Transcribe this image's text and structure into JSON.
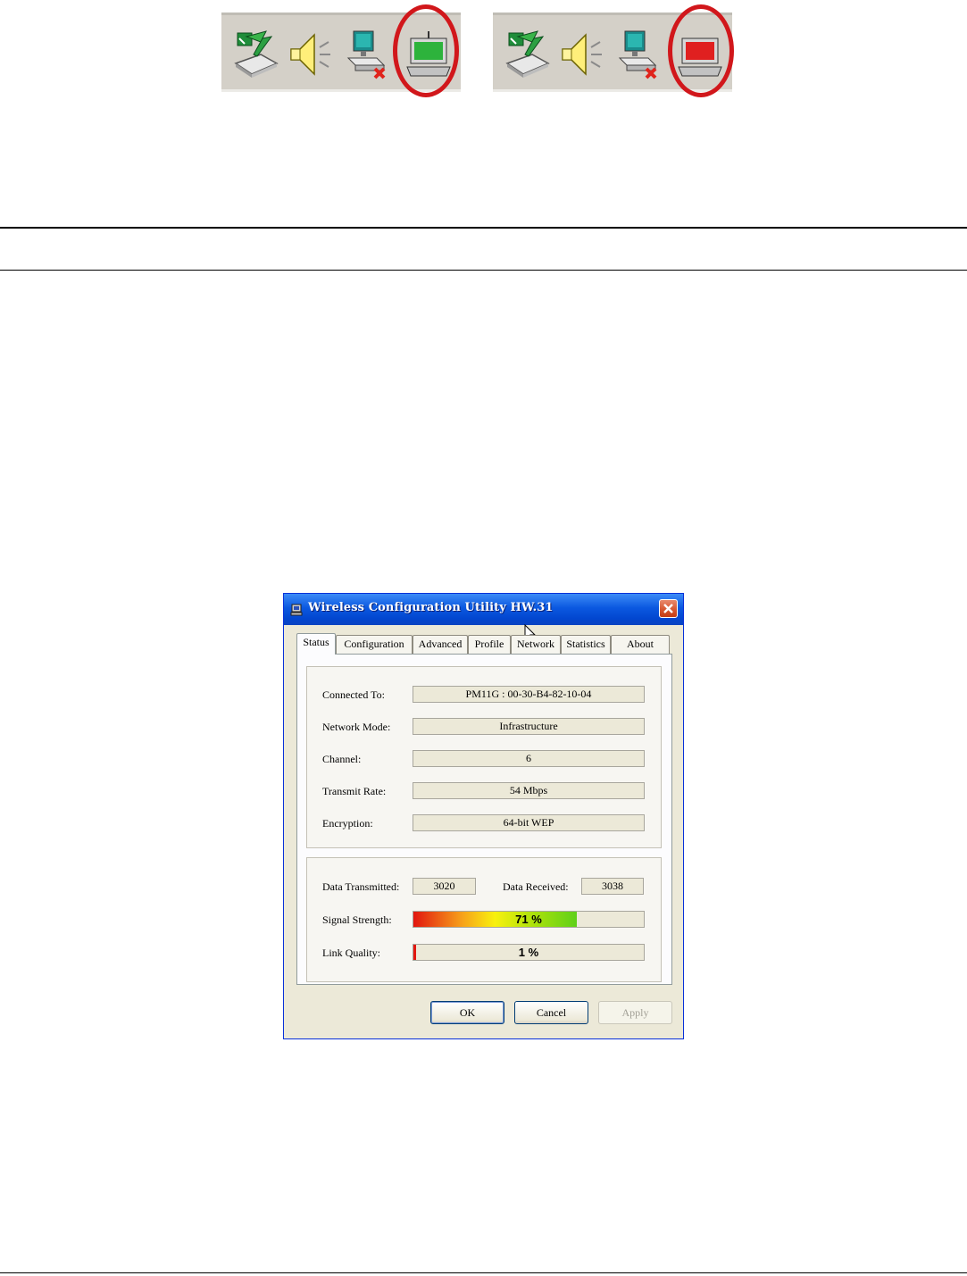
{
  "tray_left": {
    "icons": [
      "scanner-icon",
      "volume-icon",
      "network-disconnected-icon",
      "wireless-utility-connected-icon"
    ],
    "status_color": "#2db33c"
  },
  "tray_right": {
    "icons": [
      "scanner-icon",
      "volume-icon",
      "network-disconnected-icon",
      "wireless-utility-disconnected-icon"
    ],
    "status_color": "#e02020"
  },
  "highlight_color": "#d1171b",
  "dialog": {
    "title": "Wireless Configuration Utility HW.31",
    "tabs": [
      {
        "label": "Status",
        "active": true
      },
      {
        "label": "Configuration",
        "active": false
      },
      {
        "label": "Advanced",
        "active": false
      },
      {
        "label": "Profile",
        "active": false
      },
      {
        "label": "Network",
        "active": false
      },
      {
        "label": "Statistics",
        "active": false
      },
      {
        "label": "About",
        "active": false
      }
    ],
    "info": [
      {
        "label": "Connected To:",
        "value": "PM11G : 00-30-B4-82-10-04"
      },
      {
        "label": "Network Mode:",
        "value": "Infrastructure"
      },
      {
        "label": "Channel:",
        "value": "6"
      },
      {
        "label": "Transmit Rate:",
        "value": "54 Mbps"
      },
      {
        "label": "Encryption:",
        "value": "64-bit WEP"
      }
    ],
    "data_transmitted_label": "Data Transmitted:",
    "data_transmitted": "3020",
    "data_received_label": "Data Received:",
    "data_received": "3038",
    "signal_strength_label": "Signal Strength:",
    "signal_strength": "71 %",
    "signal_strength_fraction": 0.71,
    "link_quality_label": "Link Quality:",
    "link_quality": "1 %",
    "link_quality_fraction": 0.01,
    "buttons": {
      "ok": "OK",
      "cancel": "Cancel",
      "apply": "Apply"
    }
  }
}
